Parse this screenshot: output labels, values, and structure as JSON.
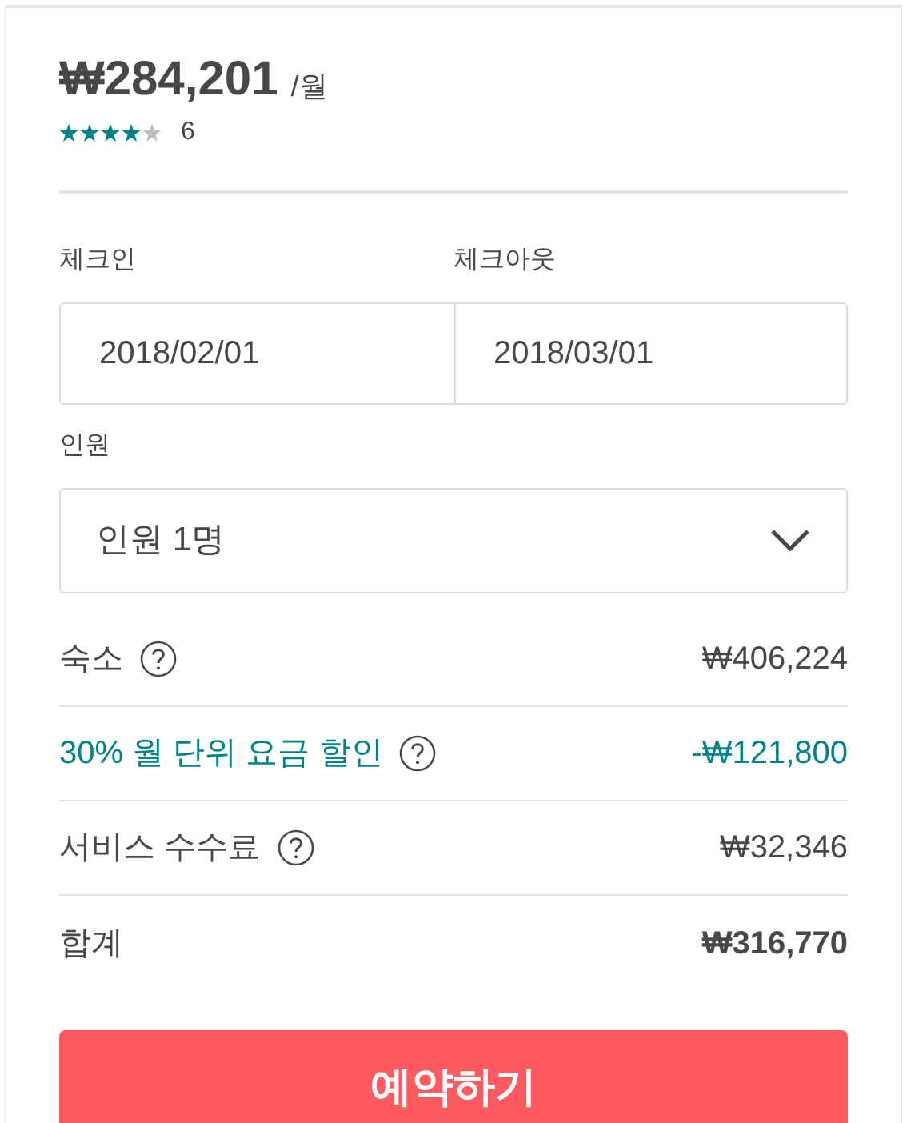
{
  "price": {
    "amount": "₩284,201",
    "unit": "/월"
  },
  "rating": {
    "stars": 4,
    "count": "6"
  },
  "dates": [
    {
      "label": "체크인",
      "value": "2018/02/01"
    },
    {
      "label": "체크아웃",
      "value": "2018/03/01"
    }
  ],
  "guests": {
    "label": "인원",
    "value": "인원 1명"
  },
  "lines": [
    {
      "kind": "normal",
      "label": "숙소",
      "help": true,
      "amount": "₩406,224"
    },
    {
      "kind": "discount",
      "label": "30% 월 단위 요금 할인",
      "help": true,
      "amount": "-₩121,800"
    },
    {
      "kind": "normal",
      "label": "서비스 수수료",
      "help": true,
      "amount": "₩32,346"
    },
    {
      "kind": "total",
      "label": "합계",
      "help": false,
      "amount": "₩316,770"
    }
  ],
  "book_button": "예약하기"
}
